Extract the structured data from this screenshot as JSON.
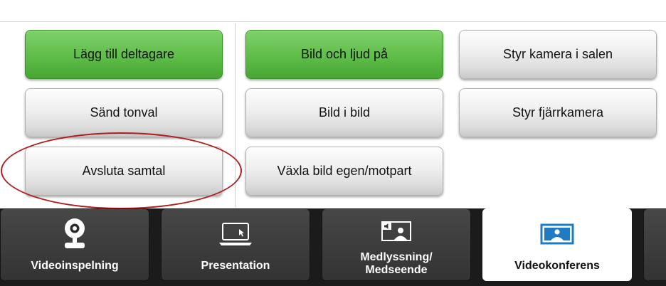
{
  "buttons": {
    "add_participant": "Lägg till deltagare",
    "dtmf": "Sänd tonval",
    "end_call": "Avsluta samtal",
    "video_audio_on": "Bild och ljud på",
    "pip": "Bild i bild",
    "switch_view": "Växla bild egen/motpart",
    "room_camera": "Styr kamera i salen",
    "far_camera": "Styr fjärrkamera"
  },
  "tabs": [
    {
      "label": "Videoinspelning",
      "icon": "webcam-icon"
    },
    {
      "label": "Presentation",
      "icon": "laptop-icon"
    },
    {
      "label_line1": "Medlyssning/",
      "label_line2": "Medseende",
      "icon": "screen-share-icon"
    },
    {
      "label": "Videokonferens",
      "icon": "video-conference-icon",
      "active": true
    }
  ],
  "colors": {
    "green_button": "#5fbd49",
    "highlight_ellipse": "#b01e1e",
    "tab_dark": "#3a3a3a",
    "accent_blue": "#1f7bc4"
  }
}
